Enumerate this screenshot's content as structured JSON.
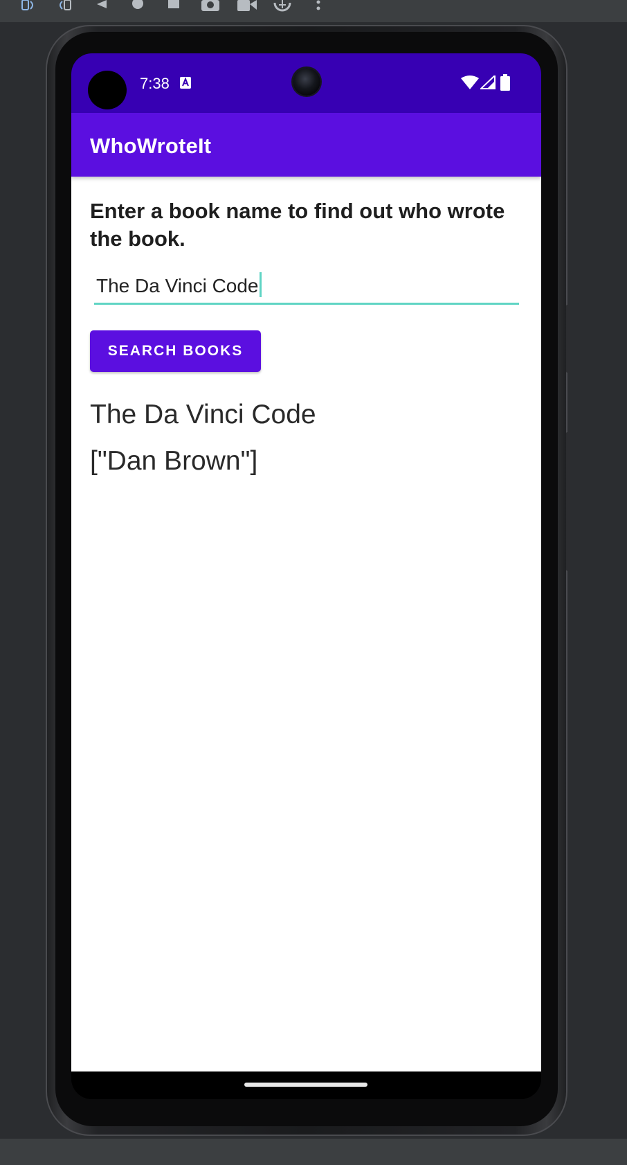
{
  "emulator": {
    "toolbar_icons": [
      "rotate-left-icon",
      "rotate-right-icon",
      "back-icon",
      "home-icon",
      "overview-icon",
      "screenshot-icon",
      "record-icon",
      "zoom-icon",
      "more-icon"
    ]
  },
  "status_bar": {
    "time": "7:38",
    "icons": [
      "notification-a-icon",
      "wifi-icon",
      "cellular-icon",
      "battery-icon"
    ]
  },
  "app_bar": {
    "title": "WhoWroteIt"
  },
  "main": {
    "prompt": "Enter a book name to find out who wrote the book.",
    "book_input": {
      "value": "The Da Vinci Code"
    },
    "search_button_label": "SEARCH BOOKS",
    "result_title": "The Da Vinci Code",
    "result_author": "[\"Dan Brown\"]"
  },
  "colors": {
    "status_bar": "#3700b3",
    "primary": "#5b0fe0",
    "accent": "#5fd4c4"
  }
}
